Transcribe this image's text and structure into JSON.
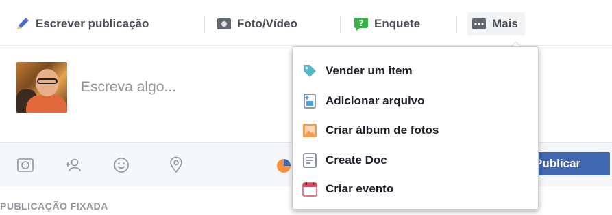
{
  "tabs": {
    "write_label": "Escrever publicação",
    "photo_label": "Foto/Vídeo",
    "poll_label": "Enquete",
    "more_label": "Mais"
  },
  "composer": {
    "placeholder": "Escreva algo..."
  },
  "toolbar": {
    "publish_label": "Publicar",
    "icons": [
      "camera-icon",
      "tag-friends-icon",
      "emoji-icon",
      "location-icon"
    ]
  },
  "feed": {
    "pinned_label": "PUBLICAÇÃO FIXADA"
  },
  "more_menu": {
    "items": [
      {
        "label": "Vender um item",
        "icon": "tag-icon"
      },
      {
        "label": "Adicionar arquivo",
        "icon": "add-file-icon"
      },
      {
        "label": "Criar álbum de fotos",
        "icon": "photo-album-icon"
      },
      {
        "label": "Create Doc",
        "icon": "doc-icon"
      },
      {
        "label": "Criar evento",
        "icon": "calendar-icon"
      }
    ]
  },
  "colors": {
    "brand_blue": "#4267b2",
    "text": "#1d2129",
    "muted": "#90949c"
  }
}
